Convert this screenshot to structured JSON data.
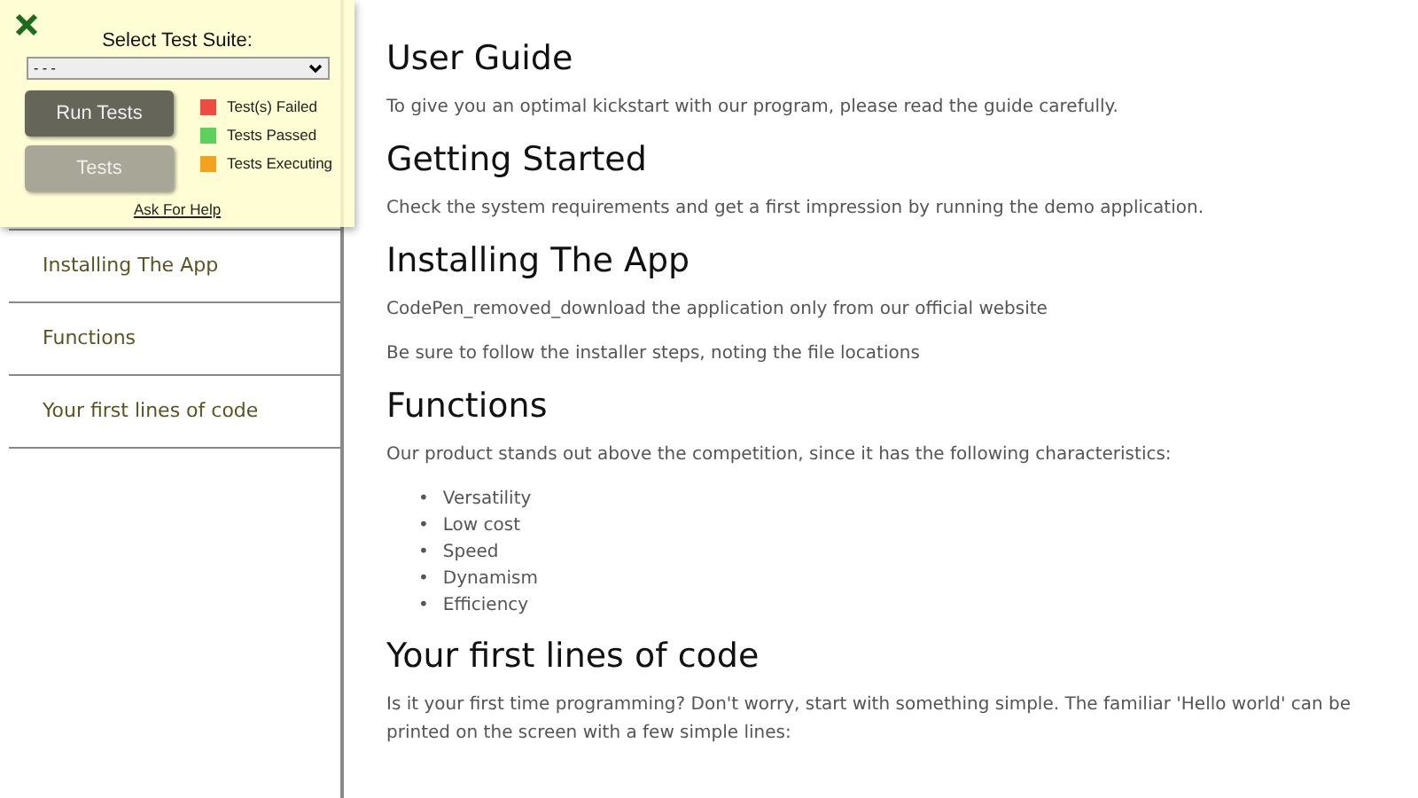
{
  "sidebar": {
    "items": [
      {
        "label": "Installing The App"
      },
      {
        "label": "Functions"
      },
      {
        "label": "Your first lines of code"
      }
    ]
  },
  "test_panel": {
    "title": "Select Test Suite:",
    "select_value": "- - -",
    "buttons": [
      "Run Tests",
      "Tests"
    ],
    "legend": [
      {
        "label": "Test(s) Failed",
        "color": "#f04b42"
      },
      {
        "label": "Tests Passed",
        "color": "#5bd25b"
      },
      {
        "label": "Tests Executing",
        "color": "#f5a21b"
      }
    ],
    "help_link": "Ask For Help"
  },
  "sections": [
    {
      "heading": "User Guide",
      "paragraphs": [
        "To give you an optimal kickstart with our program, please read the guide carefully."
      ]
    },
    {
      "heading": "Getting Started",
      "paragraphs": [
        "Check the system requirements and get a first impression by running the demo application."
      ]
    },
    {
      "heading": "Installing The App",
      "paragraphs": [
        "CodePen_removed_download the application only from our official website",
        "Be sure to follow the installer steps, noting the file locations"
      ]
    },
    {
      "heading": "Functions",
      "paragraphs": [
        "Our product stands out above the competition, since it has the following characteristics:"
      ],
      "list": [
        {
          "marker": "•",
          "label": "Versatility"
        },
        {
          "marker": "•",
          "label": "Low cost"
        },
        {
          "marker": "•",
          "label": "Speed"
        },
        {
          "marker": "•",
          "label": "Dynamism"
        },
        {
          "marker": "•",
          "label": "Efficiency"
        }
      ]
    },
    {
      "heading": "Your first lines of code",
      "paragraphs": [
        "Is it your first time programming? Don't worry, start with something simple. The familiar 'Hello world' can be printed on the screen with a few simple lines:"
      ]
    }
  ]
}
